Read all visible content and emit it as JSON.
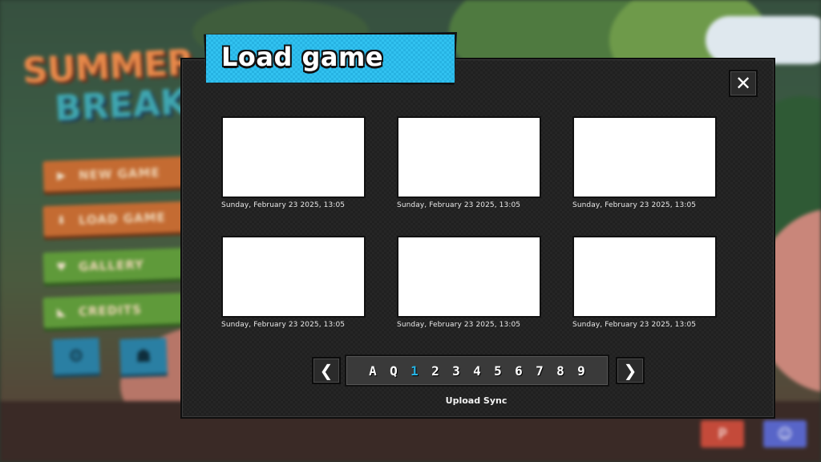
{
  "dialog": {
    "title": "Load game",
    "close_icon": "✕"
  },
  "slots": [
    {
      "date": "Sunday, February 23 2025, 13:05"
    },
    {
      "date": "Sunday, February 23 2025, 13:05"
    },
    {
      "date": "Sunday, February 23 2025, 13:05"
    },
    {
      "date": "Sunday, February 23 2025, 13:05"
    },
    {
      "date": "Sunday, February 23 2025, 13:05"
    },
    {
      "date": "Sunday, February 23 2025, 13:05"
    }
  ],
  "pagination": {
    "prev_icon": "chevron-left-icon",
    "next_icon": "chevron-right-icon",
    "pages": [
      "A",
      "Q",
      "1",
      "2",
      "3",
      "4",
      "5",
      "6",
      "7",
      "8",
      "9"
    ],
    "active_page": "1",
    "active_color": "#27b3e3"
  },
  "upload_sync": "Upload Sync",
  "background_menu": {
    "logo_line1": "SUMMER",
    "logo_line2": "BREAK",
    "buttons": [
      "NEW GAME",
      "LOAD GAME",
      "GALLERY",
      "CREDITS"
    ]
  },
  "colors": {
    "accent": "#27b3e3",
    "dialog_bg": "#202020",
    "orange_button": "#c46b32",
    "green_button": "#5f9a3a"
  }
}
